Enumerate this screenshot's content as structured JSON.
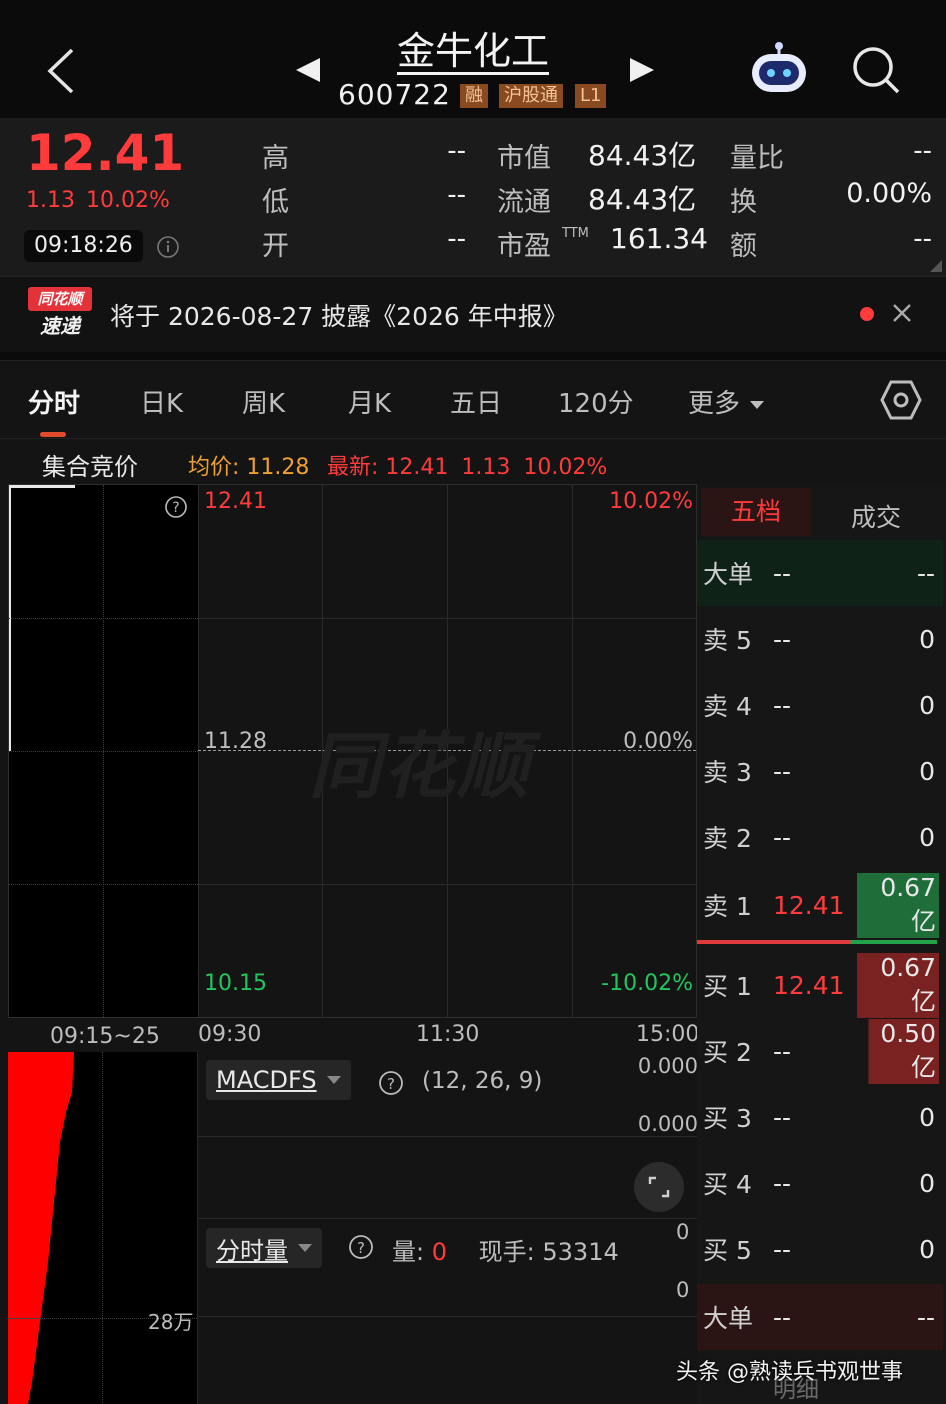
{
  "header": {
    "back_icon": "chevron-left-icon",
    "stock_name": "金牛化工",
    "stock_code": "600722",
    "tags": [
      "融",
      "沪股通",
      "L1"
    ],
    "robot_icon": "robot-icon",
    "search_icon": "search-icon"
  },
  "quote": {
    "price": "12.41",
    "change": "1.13",
    "change_pct": "10.02%",
    "time": "09:18:26",
    "stats": [
      {
        "label": "高",
        "value": "--"
      },
      {
        "label": "低",
        "value": "--"
      },
      {
        "label": "开",
        "value": "--"
      },
      {
        "label": "市值",
        "value": "84.43亿"
      },
      {
        "label": "流通",
        "value": "84.43亿"
      },
      {
        "label": "市盈",
        "sup": "TTM",
        "value": "161.34"
      },
      {
        "label": "量比",
        "value": "--"
      },
      {
        "label": "换",
        "value": "0.00%"
      },
      {
        "label": "额",
        "value": "--"
      }
    ]
  },
  "notice": {
    "logo_line1": "同花顺",
    "logo_line2": "速递",
    "text": "将于 2026-08-27 披露《2026 年中报》"
  },
  "tabs": [
    "分时",
    "日K",
    "周K",
    "月K",
    "五日",
    "120分",
    "更多"
  ],
  "subbar": {
    "auction": "集合竞价",
    "avg_label": "均价:",
    "avg_value": "11.28",
    "latest_label": "最新:",
    "latest_value": "12.41",
    "latest_change": "1.13",
    "latest_pct": "10.02%"
  },
  "chart": {
    "top_price": "12.41",
    "top_pct": "10.02%",
    "mid_price": "11.28",
    "mid_pct": "0.00%",
    "bottom_price": "10.15",
    "bottom_pct": "-10.02%",
    "watermark": "同花顺",
    "time_labels": [
      "09:15~25",
      "09:30",
      "11:30",
      "15:00"
    ],
    "macd_name": "MACDFS",
    "macd_params": "(12, 26, 9)",
    "macd_val1": "0.000",
    "macd_val2": "0.000",
    "vol_name": "分时量",
    "vol_label": "量:",
    "vol_value": "0",
    "hand_label": "现手:",
    "hand_value": "53314",
    "vol_axis1": "0",
    "vol_axis2": "0",
    "vol_auction_label": "28万"
  },
  "orderbook": {
    "tab_active": "五档",
    "tab_other": "成交",
    "big_top": {
      "label": "大单",
      "price": "--",
      "vol": "--"
    },
    "asks": [
      {
        "label": "卖 5",
        "price": "--",
        "vol": "0"
      },
      {
        "label": "卖 4",
        "price": "--",
        "vol": "0"
      },
      {
        "label": "卖 3",
        "price": "--",
        "vol": "0"
      },
      {
        "label": "卖 2",
        "price": "--",
        "vol": "0"
      },
      {
        "label": "卖 1",
        "price": "12.41",
        "vol": "0.67亿"
      }
    ],
    "bids": [
      {
        "label": "买 1",
        "price": "12.41",
        "vol": "0.67亿"
      },
      {
        "label": "买 2",
        "price": "--",
        "vol": "0.50亿"
      },
      {
        "label": "买 3",
        "price": "--",
        "vol": "0"
      },
      {
        "label": "买 4",
        "price": "--",
        "vol": "0"
      },
      {
        "label": "买 5",
        "price": "--",
        "vol": "0"
      }
    ],
    "big_bottom": {
      "label": "大单",
      "price": "--",
      "vol": "--"
    },
    "detail": "明细"
  },
  "footer_watermark": "头条 @熟读兵书观世事",
  "colors": {
    "up": "#ff3b3b",
    "down": "#22c55e",
    "accent": "#e24a2f"
  }
}
